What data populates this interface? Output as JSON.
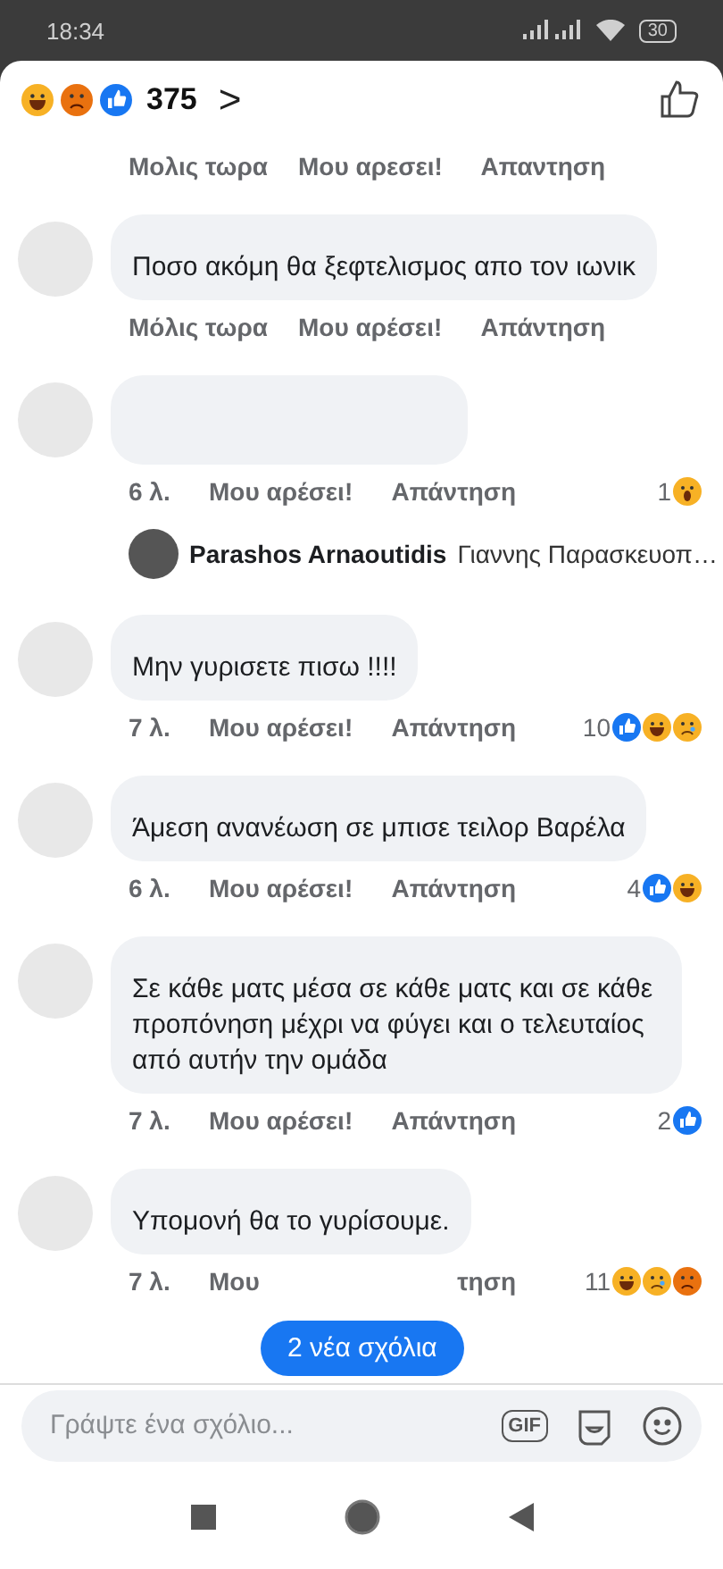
{
  "status_bar": {
    "time": "18:34",
    "battery": "30"
  },
  "header": {
    "reactions": [
      {
        "kind": "haha"
      },
      {
        "kind": "angry"
      },
      {
        "kind": "like"
      }
    ],
    "count": "375",
    "chevron": ">"
  },
  "previous_meta": {
    "time": "Μολις τωρα",
    "like": "Μου αρεσει!",
    "reply": "Απαντηση"
  },
  "comments": [
    {
      "kind": "comment",
      "text": "Ποσο ακόμη θα ξεφτελισμος απο τον ιωνικ",
      "time": "Μόλις τωρα",
      "like": "Μου αρέσει!",
      "reply": "Απάντηση"
    },
    {
      "kind": "comment",
      "time": "6 λ.",
      "like": "Μου αρέσει!",
      "reply": "Απάντηση",
      "count": "1",
      "reactions": [
        {
          "kind": "wow"
        }
      ]
    },
    {
      "kind": "reply_preview",
      "author": "Parashos Arnaoutidis",
      "text": "Γιαννης Παρασκευοπ…"
    },
    {
      "kind": "comment",
      "text": "Μην γυρισετε πισω !!!!",
      "time": "7 λ.",
      "like": "Μου αρέσει!",
      "reply": "Απάντηση",
      "count": "10",
      "reactions": [
        {
          "kind": "like"
        },
        {
          "kind": "haha"
        },
        {
          "kind": "sad"
        }
      ]
    },
    {
      "kind": "comment",
      "text": "Άμεση ανανέωση σε μπισε τειλορ Βαρέλα",
      "time": "6 λ.",
      "like": "Μου αρέσει!",
      "reply": "Απάντηση",
      "count": "4",
      "reactions": [
        {
          "kind": "like"
        },
        {
          "kind": "haha"
        }
      ]
    },
    {
      "kind": "comment",
      "text": "Σε κάθε ματς μέσα σε κάθε ματς και σε κάθε προπόνηση μέχρι να φύγει και ο τελευταίος από αυτήν την ομάδα",
      "time": "7 λ.",
      "like": "Μου αρέσει!",
      "reply": "Απάντηση",
      "count": "2",
      "reactions": [
        {
          "kind": "like"
        }
      ]
    },
    {
      "kind": "comment",
      "text": "Υπομονή θα το γυρίσουμε.",
      "time": "7 λ.",
      "like": "Μου",
      "reply": "τηση",
      "count": "11",
      "reactions": [
        {
          "kind": "haha"
        },
        {
          "kind": "sad"
        },
        {
          "kind": "angry"
        }
      ]
    }
  ],
  "new_comments_button": "2 νέα σχόλια",
  "composer": {
    "placeholder": "Γράψτε ένα σχόλιο...",
    "gif": "GIF"
  }
}
